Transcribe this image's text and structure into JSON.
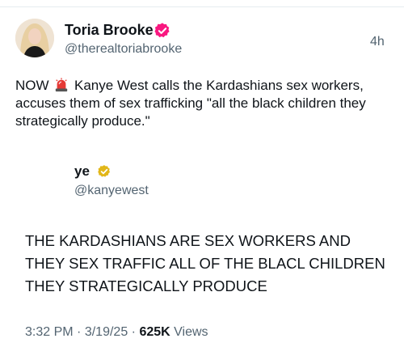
{
  "tweet": {
    "author_name": "Toria Brooke",
    "author_handle": "@therealtoriabrooke",
    "time_ago": "4h",
    "text_prefix": "NOW",
    "text_body": "Kanye West calls the Kardashians sex workers, accuses them of sex trafficking \"all the black children they strategically produce.\"",
    "avatar_icon": "profile-photo",
    "verified_icon": "verified-badge-icon",
    "siren_icon": "siren-emoji-icon",
    "colors": {
      "verified_badge": "#f91880",
      "secondary_text": "#536471",
      "primary_text": "#0f1419"
    }
  },
  "quoted": {
    "author_name": "ye",
    "author_handle": "@kanyewest",
    "verified_icon": "gold-verified-badge-icon",
    "text": "THE KARDASHIANS ARE SEX WORKERS AND THEY SEX TRAFFIC ALL OF THE BLACL CHILDREN THEY STRATEGICALLY PRODUCE",
    "time": "3:32 PM",
    "date": "3/19/25",
    "views_count": "625K",
    "views_label": "Views",
    "colors": {
      "gold_badge": "#e2b719"
    }
  }
}
